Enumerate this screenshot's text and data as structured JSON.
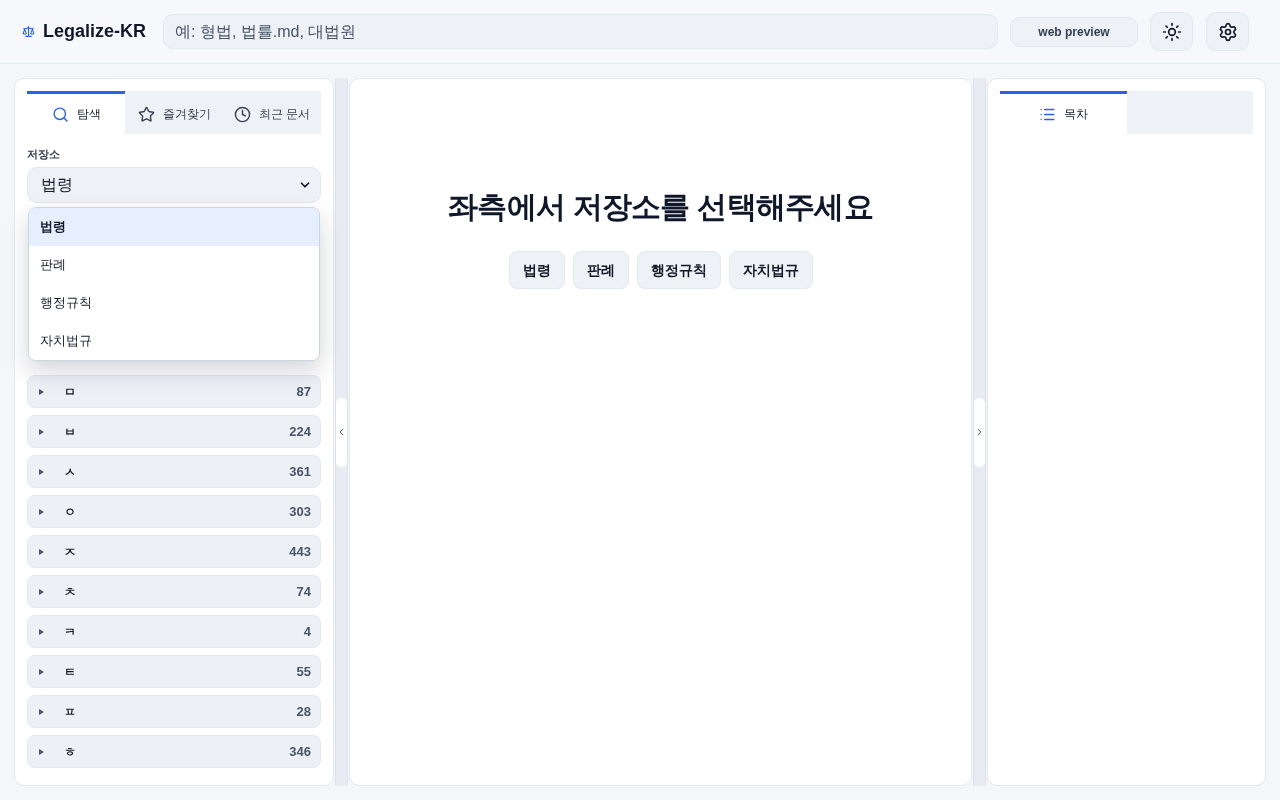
{
  "header": {
    "title": "Legalize-KR",
    "search": {
      "placeholder": "예: 형법, 법률.md, 대법원"
    },
    "buttons": [
      {
        "kind": "text",
        "label": "web preview"
      },
      {
        "kind": "theme"
      },
      {
        "kind": "settings"
      }
    ]
  },
  "left_panel": {
    "tabs": [
      {
        "label": "탐색",
        "selected": true
      },
      {
        "label": "즐겨찾기",
        "selected": false
      },
      {
        "label": "최근 문서",
        "selected": false
      }
    ],
    "repository": {
      "label": "저장소",
      "value": "법령",
      "expanded": true,
      "options": [
        {
          "label": "법령",
          "selected": true
        },
        {
          "label": "판례",
          "selected": false
        },
        {
          "label": "행정규칙",
          "selected": false
        },
        {
          "label": "자치법규",
          "selected": false
        }
      ]
    },
    "groups": [
      {
        "letter": "ㅁ",
        "count": "87",
        "expanded": false
      },
      {
        "letter": "ㅂ",
        "count": "224",
        "expanded": false
      },
      {
        "letter": "ㅅ",
        "count": "361",
        "expanded": false
      },
      {
        "letter": "ㅇ",
        "count": "303",
        "expanded": false
      },
      {
        "letter": "ㅈ",
        "count": "443",
        "expanded": false
      },
      {
        "letter": "ㅊ",
        "count": "74",
        "expanded": false
      },
      {
        "letter": "ㅋ",
        "count": "4",
        "expanded": false
      },
      {
        "letter": "ㅌ",
        "count": "55",
        "expanded": false
      },
      {
        "letter": "ㅍ",
        "count": "28",
        "expanded": false
      },
      {
        "letter": "ㅎ",
        "count": "346",
        "expanded": false
      }
    ]
  },
  "center": {
    "message": "좌측에서 저장소를 선택해주세요",
    "buttons": [
      "법령",
      "판례",
      "행정규칙",
      "자치법규"
    ]
  },
  "right_panel": {
    "tabs": [
      {
        "label": "목차",
        "selected": true
      }
    ]
  }
}
